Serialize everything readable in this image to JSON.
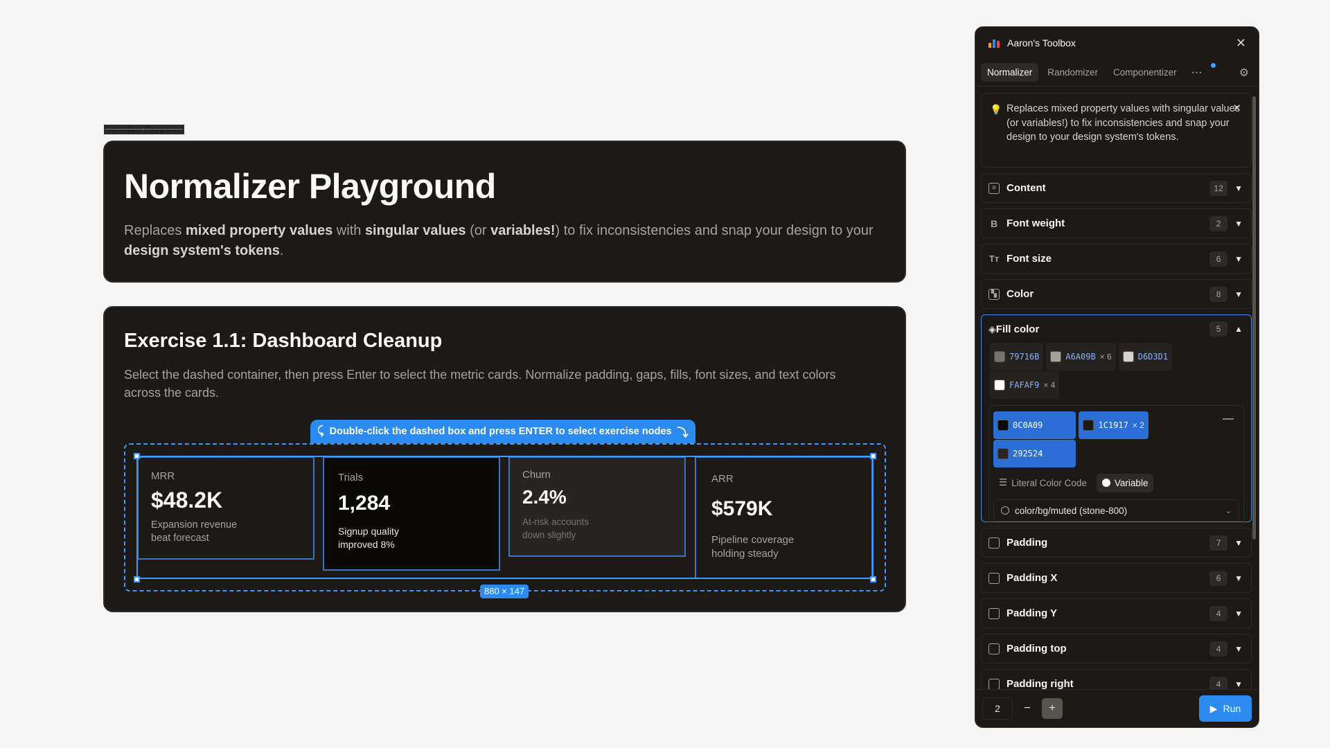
{
  "canvas": {
    "frame_label": "Normalizer Playground",
    "hero": {
      "title": "Normalizer Playground",
      "desc_1": "Replaces ",
      "desc_b1": "mixed property values",
      "desc_2": " with ",
      "desc_b2": "singular values",
      "desc_3": " (or ",
      "desc_b3": "variables!",
      "desc_4": ") to fix inconsistencies and snap your design to your ",
      "desc_b4": "design system's tokens",
      "desc_5": "."
    },
    "exercise": {
      "title": "Exercise 1.1: Dashboard Cleanup",
      "desc": "Select the dashed container, then press Enter to select the metric cards. Normalize padding, gaps, fills, font sizes, and text colors across the cards.",
      "hint": "Double-click the dashed box and press ENTER to select exercise nodes",
      "dimensions": "880 × 147"
    },
    "cards": [
      {
        "label": "MRR",
        "value": "$48.2K",
        "sub1": "Expansion revenue",
        "sub2": "beat forecast"
      },
      {
        "label": "Trials",
        "value": "1,284",
        "sub1": "Signup quality",
        "sub2": "improved 8%"
      },
      {
        "label": "Churn",
        "value": "2.4%",
        "sub1": "At-risk accounts",
        "sub2": "down slightly"
      },
      {
        "label": "ARR",
        "value": "$579K",
        "sub1": "Pipeline coverage",
        "sub2": "holding steady"
      }
    ]
  },
  "panel": {
    "title": "Aaron's Toolbox",
    "tabs": [
      "Normalizer",
      "Randomizer",
      "Componentizer"
    ],
    "info": "Replaces mixed property values with singular values (or variables!) to fix inconsistencies and snap your design to your design system's tokens.",
    "sections": [
      {
        "label": "Content",
        "count": "12"
      },
      {
        "label": "Font weight",
        "count": "2"
      },
      {
        "label": "Font size",
        "count": "6"
      },
      {
        "label": "Color",
        "count": "8"
      }
    ],
    "fill": {
      "label": "Fill color",
      "count": "5",
      "chips": [
        {
          "code": "79716B",
          "mult": "",
          "color": "#79716b"
        },
        {
          "code": "A6A09B",
          "mult": "× 6",
          "color": "#a6a09b"
        },
        {
          "code": "D6D3D1",
          "mult": "",
          "color": "#d6d3d1"
        },
        {
          "code": "FAFAF9",
          "mult": "× 4",
          "color": "#fafaf9"
        }
      ],
      "group_chips": [
        {
          "code": "0C0A09",
          "mult": "",
          "color": "#0c0a09"
        },
        {
          "code": "1C1917",
          "mult": "× 2",
          "color": "#1c1917"
        },
        {
          "code": "292524",
          "mult": "",
          "color": "#292524"
        }
      ],
      "mode_literal": "Literal Color Code",
      "mode_variable": "Variable",
      "variable": "color/bg/muted (stone-800)"
    },
    "sections_after": [
      {
        "label": "Padding",
        "count": "7"
      },
      {
        "label": "Padding X",
        "count": "6"
      },
      {
        "label": "Padding Y",
        "count": "4"
      },
      {
        "label": "Padding top",
        "count": "4"
      },
      {
        "label": "Padding right",
        "count": "4"
      }
    ],
    "footer": {
      "number": "2",
      "run": "Run"
    }
  },
  "colors": {
    "accent": "#2b8bf0",
    "panel_bg": "#1c1917",
    "card_bg": "#1c1917"
  }
}
